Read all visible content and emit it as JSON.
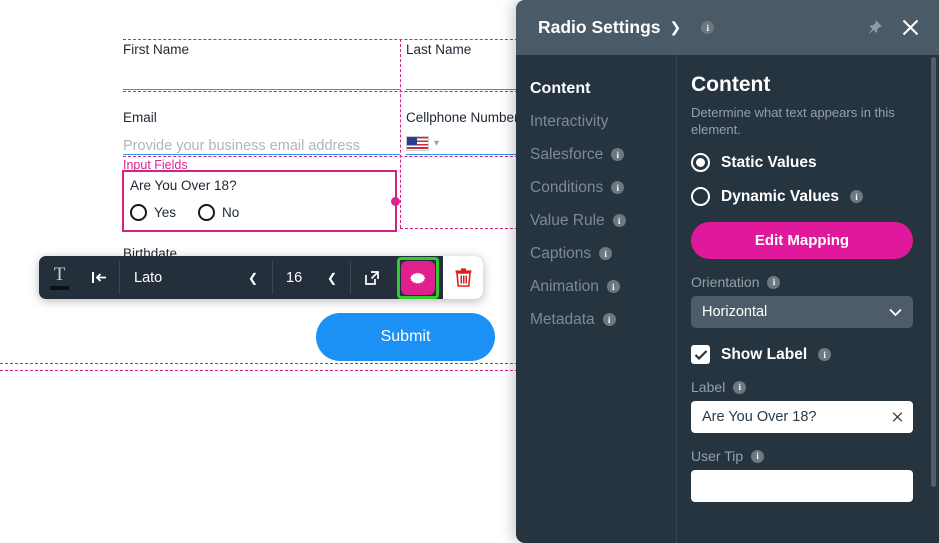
{
  "canvas": {
    "section_tag": "Input Fields",
    "fields": [
      {
        "label": "First Name",
        "placeholder": ""
      },
      {
        "label": "Last Name",
        "placeholder": ""
      },
      {
        "label": "Email",
        "placeholder": "Provide your business email address"
      },
      {
        "label": "Cellphone Number",
        "placeholder": ""
      },
      {
        "label": "Birthdate",
        "placeholder": ""
      }
    ],
    "radio_element": {
      "question": "Are You Over 18?",
      "options": [
        "Yes",
        "No"
      ]
    },
    "submit_label": "Submit"
  },
  "toolbar": {
    "text_icon": "text-color-icon",
    "align_icon": "align-left-icon",
    "font_family": "Lato",
    "font_size": "16",
    "open_icon": "external-link-icon",
    "settings_icon": "gear-icon",
    "delete_icon": "trash-icon"
  },
  "panel": {
    "title": "Radio Settings",
    "title_caret": "chevron-down-icon",
    "info_icon": "info-icon",
    "pin_icon": "pin-icon",
    "close_icon": "close-icon",
    "nav": [
      {
        "label": "Content",
        "info": false,
        "active": true
      },
      {
        "label": "Interactivity",
        "info": false,
        "active": false
      },
      {
        "label": "Salesforce",
        "info": true,
        "active": false
      },
      {
        "label": "Conditions",
        "info": true,
        "active": false
      },
      {
        "label": "Value Rule",
        "info": true,
        "active": false
      },
      {
        "label": "Captions",
        "info": true,
        "active": false
      },
      {
        "label": "Animation",
        "info": true,
        "active": false
      },
      {
        "label": "Metadata",
        "info": true,
        "active": false
      }
    ],
    "content": {
      "heading": "Content",
      "description": "Determine what text appears in this element.",
      "static_values_label": "Static Values",
      "dynamic_values_label": "Dynamic Values",
      "edit_mapping_label": "Edit Mapping",
      "orientation_label": "Orientation",
      "orientation_value": "Horizontal",
      "show_label_label": "Show Label",
      "label_label": "Label",
      "label_value": "Are You Over 18?",
      "user_tip_label": "User Tip",
      "user_tip_value": ""
    }
  },
  "colors": {
    "accent_magenta": "#e0189b",
    "selection_pink": "#d6217f",
    "highlight_green": "#2ecc2e",
    "submit_blue": "#1b90f5",
    "panel_bg": "#263440",
    "panel_header": "#4a5a66"
  }
}
